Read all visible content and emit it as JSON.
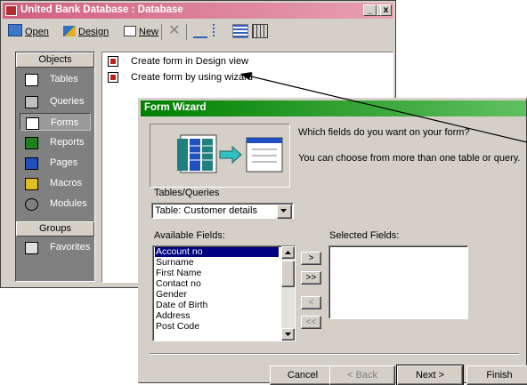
{
  "db_window": {
    "title": "United Bank Database : Database",
    "controls": {
      "minimize": "_",
      "maximize": "□",
      "close": "x"
    },
    "toolbar": {
      "open": "Open",
      "design": "Design",
      "new": "New"
    },
    "sidebar": {
      "objects_header": "Objects",
      "items": [
        {
          "label": "Tables",
          "icon": "table-icon"
        },
        {
          "label": "Queries",
          "icon": "query-icon"
        },
        {
          "label": "Forms",
          "icon": "form-icon",
          "selected": true
        },
        {
          "label": "Reports",
          "icon": "report-icon"
        },
        {
          "label": "Pages",
          "icon": "page-icon"
        },
        {
          "label": "Macros",
          "icon": "macro-icon"
        },
        {
          "label": "Modules",
          "icon": "module-icon"
        }
      ],
      "groups_header": "Groups",
      "favorites": "Favorites"
    },
    "list": [
      {
        "label": "Create form in Design view"
      },
      {
        "label": "Create form by using wizard"
      }
    ]
  },
  "wizard": {
    "title": "Form Wizard",
    "question": "Which fields do you want on your form?",
    "hint": "You can choose from more than one table or query.",
    "tables_label": "Tables/Queries",
    "tables_value": "Table: Customer details",
    "available_label": "Available Fields:",
    "selected_label": "Selected Fields:",
    "available_fields": [
      "Account no",
      "Surname",
      "First Name",
      "Contact no",
      "Gender",
      "Date of Birth",
      "Address",
      "Post Code"
    ],
    "selected_fields": [],
    "move_buttons": [
      ">",
      ">>",
      "<",
      "<<"
    ],
    "buttons": {
      "cancel": "Cancel",
      "back": "< Back",
      "next": "Next >",
      "finish": "Finish"
    }
  },
  "colors": {
    "db_title": "#d06080",
    "wizard_title": "#008000",
    "face": "#d4d0c8",
    "selection": "#000080"
  }
}
